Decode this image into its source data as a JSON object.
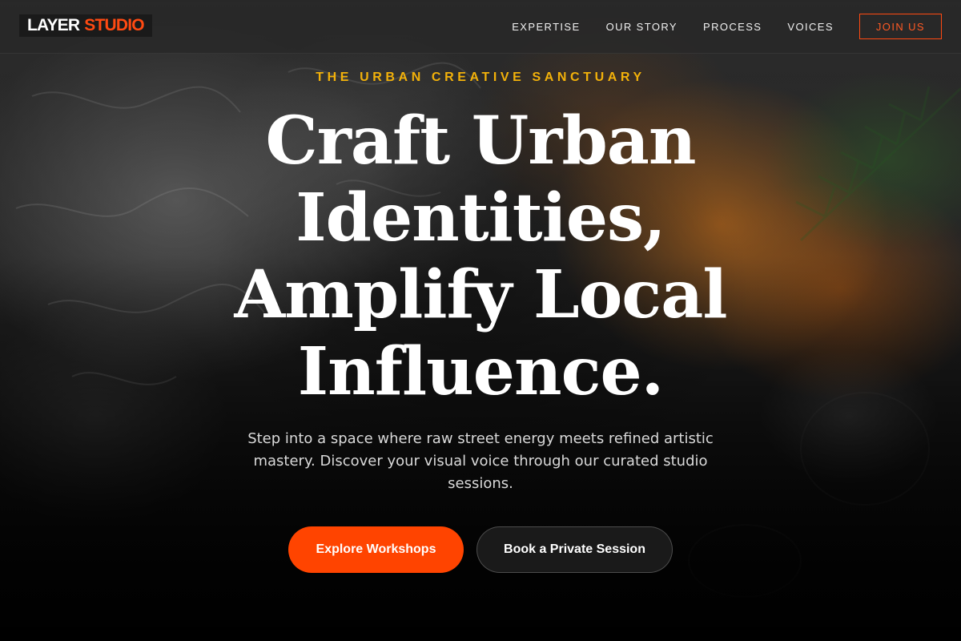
{
  "header": {
    "logo": {
      "part1": "LAYER",
      "part2": "STUDIO"
    },
    "nav": [
      {
        "label": "EXPERTISE"
      },
      {
        "label": "OUR STORY"
      },
      {
        "label": "PROCESS"
      },
      {
        "label": "VOICES"
      }
    ],
    "cta_label": "JOIN US"
  },
  "hero": {
    "eyebrow": "THE URBAN CREATIVE SANCTUARY",
    "headline_lines": [
      "Craft Urban",
      "Identities,",
      "Amplify Local",
      "Influence."
    ],
    "subtext": "Step into a space where raw street energy meets refined artistic mastery. Discover your visual voice through our curated studio sessions.",
    "primary_button": "Explore Workshops",
    "secondary_button": "Book a Private Session"
  },
  "colors": {
    "accent": "#ff4400",
    "eyebrow": "#f2b10a",
    "header_bg": "#282828",
    "text": "#ffffff"
  }
}
